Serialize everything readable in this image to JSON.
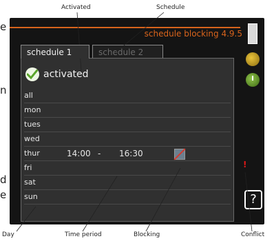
{
  "callouts": {
    "activated": "Activated",
    "schedule": "Schedule",
    "day": "Day",
    "time_period": "Time period",
    "blocking": "Blocking",
    "conflict": "Conflict"
  },
  "edge_text": {
    "right_top": "e",
    "right_mid": "n",
    "right_low_1": "d",
    "right_low_2": "e"
  },
  "screen": {
    "title": "schedule blocking 4.9.5",
    "tabs": [
      {
        "label": "schedule 1",
        "active": true
      },
      {
        "label": "schedule 2",
        "active": false
      }
    ],
    "activated_label": "activated",
    "activated_checked": true,
    "days": [
      {
        "day": "all",
        "start": "",
        "dash": "",
        "end": "",
        "blocked": false
      },
      {
        "day": "mon",
        "start": "",
        "dash": "",
        "end": "",
        "blocked": false
      },
      {
        "day": "tues",
        "start": "",
        "dash": "",
        "end": "",
        "blocked": false
      },
      {
        "day": "wed",
        "start": "",
        "dash": "",
        "end": "",
        "blocked": false
      },
      {
        "day": "thur",
        "start": "14:00",
        "dash": "-",
        "end": "16:30",
        "blocked": true
      },
      {
        "day": "fri",
        "start": "",
        "dash": "",
        "end": "",
        "blocked": false
      },
      {
        "day": "sat",
        "start": "",
        "dash": "",
        "end": "",
        "blocked": false
      },
      {
        "day": "sun",
        "start": "",
        "dash": "",
        "end": "",
        "blocked": false
      }
    ],
    "conflict_mark": "!",
    "help_label": "?",
    "icons": [
      "scrollbar-icon",
      "coin-icon",
      "clock-icon",
      "help-icon"
    ],
    "colors": {
      "accent": "#d9641c",
      "conflict": "#e01818",
      "check": "#5aa52a"
    }
  }
}
